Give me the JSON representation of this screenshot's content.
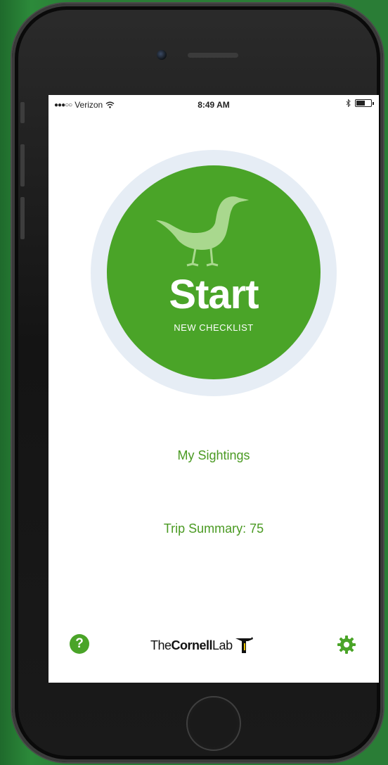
{
  "status_bar": {
    "carrier": "Verizon",
    "time": "8:49 AM"
  },
  "main": {
    "start_label": "Start",
    "start_sublabel": "NEW CHECKLIST",
    "my_sightings": "My Sightings",
    "trip_summary": "Trip Summary: 75"
  },
  "footer": {
    "help_icon": "question-circle-icon",
    "settings_icon": "gear-icon",
    "logo": {
      "part1": "The",
      "part2": "Cornell",
      "part3": "Lab"
    }
  },
  "colors": {
    "accent": "#4aa428",
    "link": "#4a9a22",
    "halo": "#e6edf5",
    "background": "#2a7d36"
  }
}
